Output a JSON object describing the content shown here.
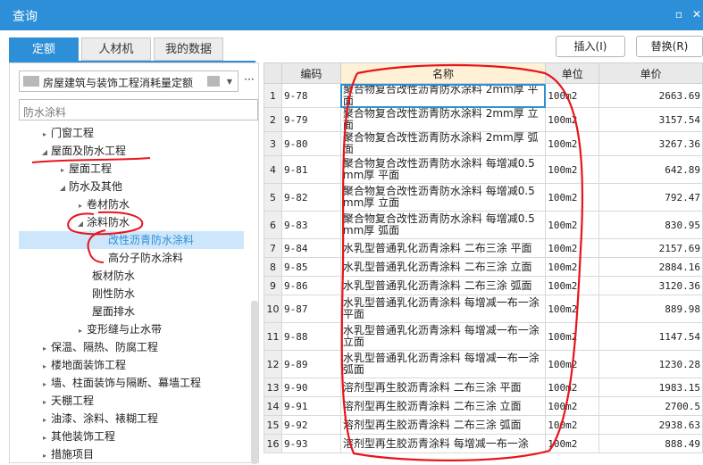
{
  "window": {
    "title": "查询",
    "restore_glyph": "▫",
    "close_glyph": "✕"
  },
  "tabs": [
    {
      "label": "定额",
      "active": true
    },
    {
      "label": "人材机",
      "active": false
    },
    {
      "label": "我的数据",
      "active": false
    }
  ],
  "actions": {
    "insert": "插入(I)",
    "replace": "替换(R)"
  },
  "left": {
    "library": "房屋建筑与装饰工程消耗量定额",
    "more": "···",
    "search_placeholder": "防水涂料",
    "tree": [
      {
        "label": "门窗工程",
        "expander": "▸"
      },
      {
        "label": "屋面及防水工程",
        "expander": "◢"
      },
      {
        "label": "屋面工程",
        "expander": "▸"
      },
      {
        "label": "防水及其他",
        "expander": "◢"
      },
      {
        "label": "卷材防水",
        "expander": "▸"
      },
      {
        "label": "涂料防水",
        "expander": "◢"
      },
      {
        "label": "改性沥青防水涂料",
        "expander": ""
      },
      {
        "label": "高分子防水涂料",
        "expander": ""
      },
      {
        "label": "板材防水",
        "expander": ""
      },
      {
        "label": "刚性防水",
        "expander": ""
      },
      {
        "label": "屋面排水",
        "expander": ""
      },
      {
        "label": "变形缝与止水带",
        "expander": "▸"
      },
      {
        "label": "保温、隔热、防腐工程",
        "expander": "▸"
      },
      {
        "label": "楼地面装饰工程",
        "expander": "▸"
      },
      {
        "label": "墙、柱面装饰与隔断、幕墙工程",
        "expander": "▸"
      },
      {
        "label": "天棚工程",
        "expander": "▸"
      },
      {
        "label": "油漆、涂料、裱糊工程",
        "expander": "▸"
      },
      {
        "label": "其他装饰工程",
        "expander": "▸"
      },
      {
        "label": "措施项目",
        "expander": "▸"
      }
    ]
  },
  "grid": {
    "headers": {
      "code": "编码",
      "name": "名称",
      "unit": "单位",
      "price": "单价"
    },
    "rows": [
      {
        "n": "1",
        "code": "9-78",
        "name": "聚合物复合改性沥青防水涂料 2mm厚 平面",
        "unit": "100m2",
        "price": "2663.69"
      },
      {
        "n": "2",
        "code": "9-79",
        "name": "聚合物复合改性沥青防水涂料 2mm厚 立面",
        "unit": "100m2",
        "price": "3157.54"
      },
      {
        "n": "3",
        "code": "9-80",
        "name": "聚合物复合改性沥青防水涂料 2mm厚 弧面",
        "unit": "100m2",
        "price": "3267.36"
      },
      {
        "n": "4",
        "code": "9-81",
        "name": "聚合物复合改性沥青防水涂料 每增减0.5mm厚 平面",
        "unit": "100m2",
        "price": "642.89"
      },
      {
        "n": "5",
        "code": "9-82",
        "name": "聚合物复合改性沥青防水涂料 每增减0.5mm厚 立面",
        "unit": "100m2",
        "price": "792.47"
      },
      {
        "n": "6",
        "code": "9-83",
        "name": "聚合物复合改性沥青防水涂料 每增减0.5mm厚 弧面",
        "unit": "100m2",
        "price": "830.95"
      },
      {
        "n": "7",
        "code": "9-84",
        "name": "水乳型普通乳化沥青涂料 二布三涂 平面",
        "unit": "100m2",
        "price": "2157.69"
      },
      {
        "n": "8",
        "code": "9-85",
        "name": "水乳型普通乳化沥青涂料 二布三涂 立面",
        "unit": "100m2",
        "price": "2884.16"
      },
      {
        "n": "9",
        "code": "9-86",
        "name": "水乳型普通乳化沥青涂料 二布三涂 弧面",
        "unit": "100m2",
        "price": "3120.36"
      },
      {
        "n": "10",
        "code": "9-87",
        "name": "水乳型普通乳化沥青涂料 每增减一布一涂 平面",
        "unit": "100m2",
        "price": "889.98"
      },
      {
        "n": "11",
        "code": "9-88",
        "name": "水乳型普通乳化沥青涂料 每增减一布一涂 立面",
        "unit": "100m2",
        "price": "1147.54"
      },
      {
        "n": "12",
        "code": "9-89",
        "name": "水乳型普通乳化沥青涂料 每增减一布一涂 弧面",
        "unit": "100m2",
        "price": "1230.28"
      },
      {
        "n": "13",
        "code": "9-90",
        "name": "溶剂型再生胶沥青涂料 二布三涂 平面",
        "unit": "100m2",
        "price": "1983.15"
      },
      {
        "n": "14",
        "code": "9-91",
        "name": "溶剂型再生胶沥青涂料 二布三涂 立面",
        "unit": "100m2",
        "price": "2700.5"
      },
      {
        "n": "15",
        "code": "9-92",
        "name": "溶剂型再生胶沥青涂料 二布三涂 弧面",
        "unit": "100m2",
        "price": "2938.63"
      },
      {
        "n": "16",
        "code": "9-93",
        "name": "溶剂型再生胶沥青涂料 每增减一布一涂",
        "unit": "100m2",
        "price": "888.49"
      }
    ]
  },
  "colors": {
    "accent": "#2d8fd7",
    "annotation": "#e8141b",
    "selection": "#cde6fb"
  }
}
